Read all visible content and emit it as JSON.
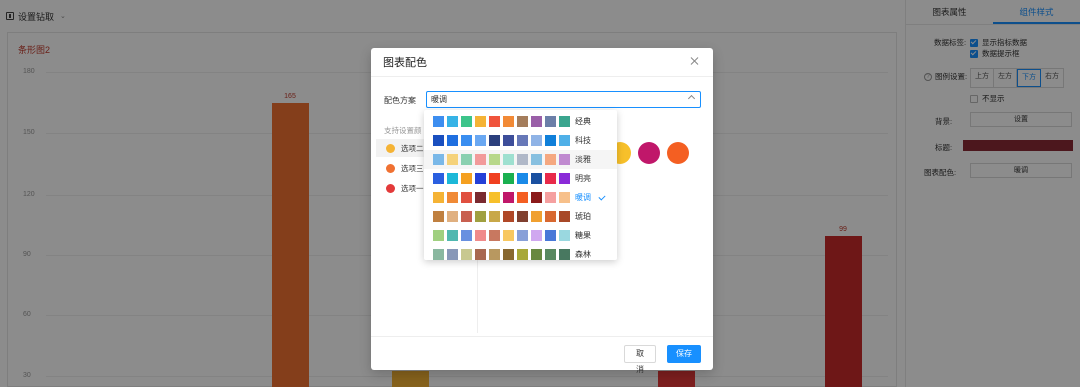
{
  "topbar": {
    "title": "设置钻取",
    "caret": "⌄"
  },
  "chart": {
    "title": "条形图2",
    "yticks": [
      "180",
      "150",
      "120",
      "90",
      "60",
      "30"
    ],
    "bar_labels": [
      "165",
      "99"
    ]
  },
  "right_panel": {
    "tabs": [
      "图表属性",
      "组件样式"
    ],
    "data_label_title": "数据标签:",
    "show_metric": "显示指标数据",
    "data_tip": "数据提示框",
    "legend_title": "图例设置:",
    "legend_options": [
      "上方",
      "左方",
      "下方",
      "右方"
    ],
    "legend_hide": "不显示",
    "background_title": "背景:",
    "background_btn": "设置",
    "title_label": "标题:",
    "title_color": "#8b2a35",
    "palette_title": "图表配色:",
    "palette_value": "暖调",
    "help": "?"
  },
  "modal": {
    "title": "图表配色",
    "scheme_label": "配色方案",
    "scheme_value": "暖调",
    "support_label": "支持设置颜",
    "options": [
      {
        "label": "选项二",
        "color": "#f5b335"
      },
      {
        "label": "选项三",
        "color": "#f07132"
      },
      {
        "label": "选项一",
        "color": "#e33a3a"
      }
    ],
    "preview_colors": [
      "#f7c02a",
      "#c0176a",
      "#f45f22"
    ],
    "cancel": "取消",
    "save": "保存"
  },
  "dropdown": {
    "selected_index": 4,
    "schemes": [
      {
        "name": "经典",
        "colors": [
          "#3d8ef0",
          "#36b3e6",
          "#3cc48a",
          "#f5b335",
          "#f0543c",
          "#f28a36",
          "#a47d5c",
          "#9a5fa8",
          "#6b7fa8",
          "#3aa58e"
        ]
      },
      {
        "name": "科技",
        "colors": [
          "#1a4fbf",
          "#1f6fe0",
          "#3a8ef0",
          "#6aa8f2",
          "#2b3f7d",
          "#3d4e9a",
          "#6778b8",
          "#8fb3e6",
          "#0f7fd9",
          "#4fb0e8"
        ]
      },
      {
        "name": "淡雅",
        "colors": [
          "#7ab8e8",
          "#f5d27a",
          "#8ad0b0",
          "#f29a9a",
          "#b8d88a",
          "#9ee0d0",
          "#b0b8c8",
          "#88c0e0",
          "#f5a880",
          "#c08ad0"
        ]
      },
      {
        "name": "明亮",
        "colors": [
          "#2a5fe0",
          "#1cb8d8",
          "#f5a020",
          "#2440d8",
          "#f04020",
          "#1ab050",
          "#1a8ae8",
          "#1a50a0",
          "#e82a4a",
          "#8a2ad8"
        ]
      },
      {
        "name": "暖调",
        "colors": [
          "#f5b335",
          "#f08a36",
          "#e05040",
          "#7a2a30",
          "#f7c02a",
          "#c0176a",
          "#f45f22",
          "#8b1a1a",
          "#f5a0a0",
          "#f7c08a"
        ]
      },
      {
        "name": "琥珀",
        "colors": [
          "#c08040",
          "#e0b080",
          "#c86050",
          "#a0a040",
          "#c8a848",
          "#b04828",
          "#804030",
          "#f0a030",
          "#d86830",
          "#a84828"
        ]
      },
      {
        "name": "糖果",
        "colors": [
          "#a0d080",
          "#50b8b0",
          "#6890e0",
          "#f08a8a",
          "#c87860",
          "#f8c860",
          "#88a0d8",
          "#d0a8f0",
          "#4878d8",
          "#9ad8e0"
        ]
      },
      {
        "name": "森林",
        "colors": [
          "#8ab8a0",
          "#8898b8",
          "#c8c890",
          "#a86850",
          "#b89860",
          "#886830",
          "#a8a838",
          "#688840",
          "#588860",
          "#487860"
        ]
      }
    ]
  }
}
